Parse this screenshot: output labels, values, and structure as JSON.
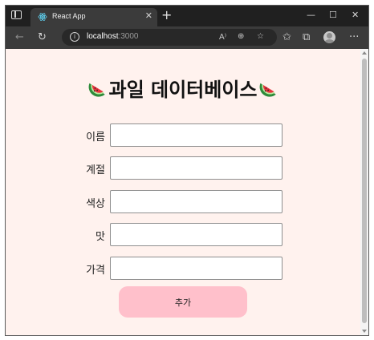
{
  "browser": {
    "tab_title": "React App",
    "tab_close_icon": "close-icon",
    "new_tab_symbol": "+",
    "url_host": "localhost",
    "url_port": ":3000",
    "info_icon_symbol": "i",
    "read_aloud_label": "A⁾"
  },
  "page": {
    "title": "과일 데이터베이스",
    "accent": "#ffc0cb",
    "background": "#fff2ee",
    "fields": [
      {
        "label": "이름",
        "value": ""
      },
      {
        "label": "계절",
        "value": ""
      },
      {
        "label": "색상",
        "value": ""
      },
      {
        "label": "맛",
        "value": ""
      },
      {
        "label": "가격",
        "value": ""
      }
    ],
    "add_button_label": "추가"
  }
}
